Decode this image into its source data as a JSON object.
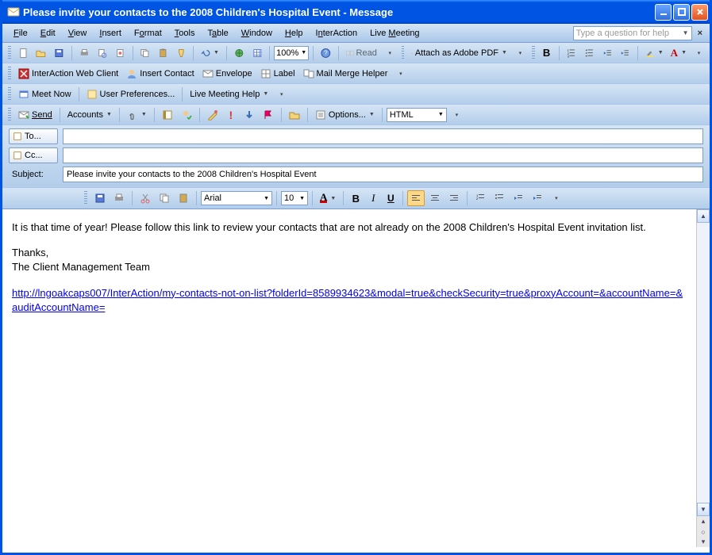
{
  "window": {
    "title": "Please invite your contacts to the 2008 Children's Hospital Event - Message"
  },
  "menu": {
    "file": "File",
    "edit": "Edit",
    "view": "View",
    "insert": "Insert",
    "format": "Format",
    "tools": "Tools",
    "table": "Table",
    "window": "Window",
    "help": "Help",
    "interaction": "InterAction",
    "livemeeting": "Live Meeting",
    "helpbox_placeholder": "Type a question for help"
  },
  "toolbar1": {
    "zoom": "100%",
    "read": "Read",
    "attach_pdf": "Attach as Adobe PDF"
  },
  "toolbar2": {
    "ia_web": "InterAction Web Client",
    "insert_contact": "Insert Contact",
    "envelope": "Envelope",
    "label": "Label",
    "mailmerge": "Mail Merge Helper"
  },
  "toolbar3": {
    "meet_now": "Meet Now",
    "user_prefs": "User Preferences...",
    "lm_help": "Live Meeting Help"
  },
  "toolbar4": {
    "send": "Send",
    "accounts": "Accounts",
    "options": "Options...",
    "format_sel": "HTML"
  },
  "fields": {
    "to": "To...",
    "to_value": "",
    "cc": "Cc...",
    "cc_value": "",
    "subject_label": "Subject:",
    "subject_value": "Please invite your contacts to the 2008 Children's Hospital Event"
  },
  "format": {
    "font": "Arial",
    "size": "10"
  },
  "body": {
    "p1": "It is that time of year! Please follow this link to review your contacts that are not already on the 2008 Children's Hospital Event invitation list.",
    "p2a": "Thanks,",
    "p2b": "The Client Management Team",
    "link": "http://lngoakcaps007/InterAction/my-contacts-not-on-list?folderId=8589934623&modal=true&checkSecurity=true&proxyAccount=&accountName=&auditAccountName="
  }
}
